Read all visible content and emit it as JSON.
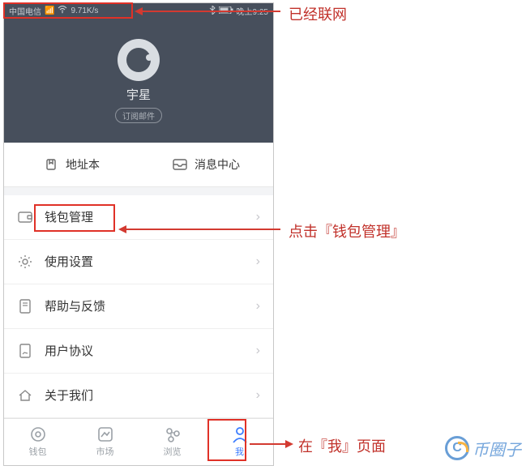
{
  "status": {
    "carrier": "中国电信",
    "speed": "9.71K/s",
    "time": "晚上9:25"
  },
  "profile": {
    "name": "宇星",
    "subscribe": "订阅邮件"
  },
  "quick": {
    "address_book": "地址本",
    "message_center": "消息中心"
  },
  "menu": {
    "wallet_mgmt": "钱包管理",
    "settings": "使用设置",
    "help": "帮助与反馈",
    "agreement": "用户协议",
    "about": "关于我们"
  },
  "nav": {
    "wallet": "钱包",
    "market": "市场",
    "browse": "浏览",
    "me": "我"
  },
  "annotations": {
    "networked": "已经联网",
    "click_wallet": "点击『钱包管理』",
    "on_me_page": "在『我』页面"
  },
  "watermark": "币圈子"
}
